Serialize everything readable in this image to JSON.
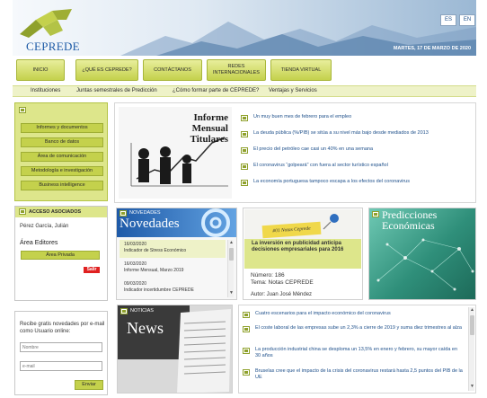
{
  "header": {
    "logo_text": "CEPREDE",
    "lang_es": "ES",
    "lang_en": "EN",
    "date": "MARTES, 17 DE MARZO DE 2020"
  },
  "nav": {
    "items": [
      "INICIO",
      "¿QUÉ ES CEPREDE?",
      "CONTÁCTANOS",
      "REDES INTERNACIONALES",
      "TIENDA VIRTUAL"
    ]
  },
  "subnav": {
    "items": [
      "Instituciones",
      "Juntas semestrales de Predicción",
      "¿Cómo formar parte de CEPREDE?",
      "Ventajas y Servicios"
    ]
  },
  "left_menu": {
    "items": [
      "Informes y documentos",
      "Banco de datos",
      "Área de comunicación",
      "Metodología e investigación",
      "Business intelligence"
    ]
  },
  "assoc": {
    "title": "ACCESO ASOCIADOS",
    "user_name": "Pérez García, Julián",
    "area_label": "Área Editores",
    "private_button": "Área Privada",
    "logout_button": "Salir"
  },
  "newsletter": {
    "text": "Recibe gratis novedades por e-mail como Usuario online:",
    "name_placeholder": "Nombre",
    "email_placeholder": "e-mail",
    "send_button": "Enviar"
  },
  "feature": {
    "title_line1": "Informe Mensual",
    "title_line2": "Titulares",
    "headlines": [
      "Un muy buen mes de febrero para el empleo",
      "La deuda pública (%/PIB) se sitúa a su nivel más bajo desde mediados de 2013",
      "El precio del petróleo cae casi un 40% en una semana",
      "El coronavirus “golpeará” con fuera al sector turístico español",
      "La economía portuguesa tampoco escapa a los efectos del coronavirus"
    ]
  },
  "novedades": {
    "label": "NOVEDADES",
    "title": "Novedades",
    "items": [
      {
        "date": "16/03/2020",
        "text": "Indicador de Stress Económico"
      },
      {
        "date": "16/03/2020",
        "text": "Informe Mensual, Marzo 2019"
      },
      {
        "date": "09/03/2020",
        "text": "Indicador incertidumbre CEPREDE"
      }
    ]
  },
  "notas": {
    "postit": "#01 Notas Ceprede",
    "headline": "La inversión en publicidad anticipa decisiones empresariales para 2016",
    "number": "Número: 186",
    "tema": "Tema: Notas CEPREDE",
    "autor": "Autor: Juan José Méndez"
  },
  "predicciones": {
    "title_line1": "Predicciones",
    "title_line2": "Económicas"
  },
  "news": {
    "label": "NOTICIAS",
    "title": "News",
    "items": [
      "Cuatro escenarios para el impacto económico del coronavirus",
      "El coste laboral de las empresas sube un 2,3% a cierre de 2019 y suma diez trimestres al alza",
      "La producción industrial china se desploma un 13,5% en enero y febrero, su mayor caída en 30 años",
      "Bruselas cree que el impacto de la crisis del coronavirus restará hasta 2,5 puntos del PIB de la UE"
    ]
  },
  "colors": {
    "lime": "#c4d14c",
    "lime_light": "#dde68b",
    "link_blue": "#1d4f8a",
    "brand_blue": "#1d5aa6"
  }
}
